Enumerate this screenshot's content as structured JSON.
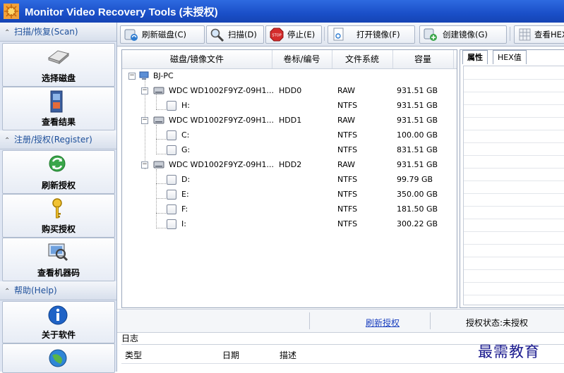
{
  "window": {
    "title": "Monitor Video Recovery Tools (未授权)"
  },
  "sidebar": {
    "sections": [
      {
        "label": "扫描/恢复(Scan)",
        "items": [
          {
            "label": "选择磁盘",
            "icon": "disk-icon"
          },
          {
            "label": "查看结果",
            "icon": "film-icon"
          }
        ]
      },
      {
        "label": "注册/授权(Register)",
        "items": [
          {
            "label": "刷新授权",
            "icon": "refresh-icon"
          },
          {
            "label": "购买授权",
            "icon": "key-icon"
          },
          {
            "label": "查看机器码",
            "icon": "machine-code-icon"
          }
        ]
      },
      {
        "label": "帮助(Help)",
        "items": [
          {
            "label": "关于软件",
            "icon": "info-icon"
          },
          {
            "label": "",
            "icon": "globe-icon"
          }
        ]
      }
    ]
  },
  "toolbar": {
    "refresh_disk": "刷新磁盘(C)",
    "scan": "扫描(D)",
    "stop": "停止(E)",
    "open_image": "打开镜像(F)",
    "create_image": "创建镜像(G)",
    "view_hex": "查看HEX"
  },
  "tree": {
    "columns": [
      "磁盘/镜像文件",
      "卷标/编号",
      "文件系统",
      "容量"
    ],
    "root": "BJ-PC",
    "rows": [
      {
        "name": "WDC WD1002F9YZ-09H1...",
        "label": "HDD0",
        "fs": "RAW",
        "size": "931.51 GB"
      },
      {
        "name": "H:",
        "label": "",
        "fs": "NTFS",
        "size": "931.51 GB"
      },
      {
        "name": "WDC WD1002F9YZ-09H1...",
        "label": "HDD1",
        "fs": "RAW",
        "size": "931.51 GB"
      },
      {
        "name": "C:",
        "label": "",
        "fs": "NTFS",
        "size": "100.00 GB"
      },
      {
        "name": "G:",
        "label": "",
        "fs": "NTFS",
        "size": "831.51 GB"
      },
      {
        "name": "WDC WD1002F9YZ-09H1...",
        "label": "HDD2",
        "fs": "RAW",
        "size": "931.51 GB"
      },
      {
        "name": "D:",
        "label": "",
        "fs": "NTFS",
        "size": "99.79 GB"
      },
      {
        "name": "E:",
        "label": "",
        "fs": "NTFS",
        "size": "350.00 GB"
      },
      {
        "name": "F:",
        "label": "",
        "fs": "NTFS",
        "size": "181.50 GB"
      },
      {
        "name": "I:",
        "label": "",
        "fs": "NTFS",
        "size": "300.22 GB"
      }
    ]
  },
  "props": {
    "tab_attr": "属性",
    "tab_hex": "HEX值"
  },
  "status": {
    "refresh_link": "刷新授权",
    "auth_status": "授权状态:未授权"
  },
  "log": {
    "title": "日志",
    "columns": [
      "类型",
      "日期",
      "描述"
    ]
  },
  "watermark": "最需教育"
}
